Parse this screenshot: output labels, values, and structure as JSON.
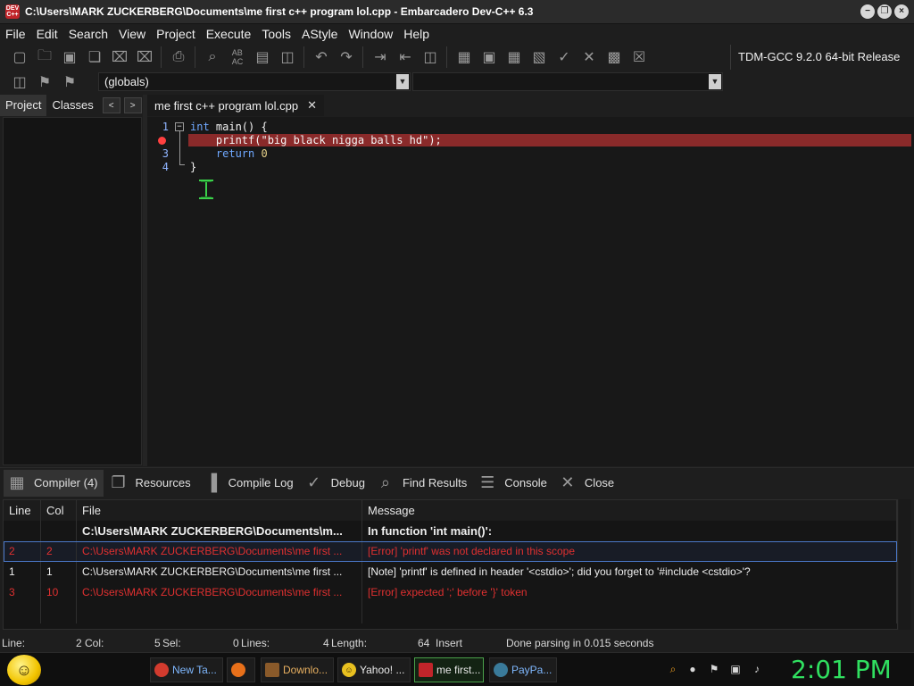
{
  "window": {
    "app_icon_text": "DEV C++",
    "title": "C:\\Users\\MARK ZUCKERBERG\\Documents\\me first c++ program lol.cpp - Embarcadero Dev-C++ 6.3",
    "minimize": "−",
    "restore": "❐",
    "close": "×"
  },
  "menu": [
    "File",
    "Edit",
    "Search",
    "View",
    "Project",
    "Execute",
    "Tools",
    "AStyle",
    "Window",
    "Help"
  ],
  "toolbar": {
    "compiler_label": "TDM-GCC 9.2.0 64-bit Release",
    "icons": [
      "new-icon",
      "open-icon",
      "save-icon",
      "save-all-icon",
      "close-file-icon",
      "close-all-icon",
      "print-icon",
      "find-icon",
      "replace-icon",
      "goto-icon",
      "toggle-view-icon",
      "undo-icon",
      "redo-icon",
      "indent-icon",
      "unindent-icon",
      "comment-icon",
      "compile-icon",
      "run-icon",
      "compile-run-icon",
      "rebuild-icon",
      "syntax-check-icon",
      "stop-icon",
      "chart-icon",
      "debug-stop-icon"
    ]
  },
  "toolbar2": {
    "class_combo": "(globals)",
    "member_combo": ""
  },
  "left_panel": {
    "tabs": [
      "Project",
      "Classes"
    ],
    "prev": "<",
    "next": ">"
  },
  "editor": {
    "tab_title": "me first c++ program lol.cpp",
    "tab_close": "✕",
    "lines": [
      {
        "num": "1",
        "pre": "",
        "kw": "int",
        "text": " main() {"
      },
      {
        "num": "",
        "pre": "    ",
        "kw": "",
        "text": "printf(\"big black nigga balls hd\");"
      },
      {
        "num": "3",
        "pre": "    ",
        "kw": "return",
        "text": " ",
        "num_lit": "0"
      },
      {
        "num": "4",
        "pre": "",
        "kw": "",
        "text": "}"
      }
    ]
  },
  "bottom_tabs": [
    {
      "label": "Compiler (4)",
      "icon": "compiler-grid-icon",
      "glyph": "▦"
    },
    {
      "label": "Resources",
      "icon": "resources-icon",
      "glyph": "❐"
    },
    {
      "label": "Compile Log",
      "icon": "compile-log-icon",
      "glyph": "▐"
    },
    {
      "label": "Debug",
      "icon": "debug-check-icon",
      "glyph": "✓"
    },
    {
      "label": "Find Results",
      "icon": "find-results-icon",
      "glyph": "⌕"
    },
    {
      "label": "Console",
      "icon": "console-icon",
      "glyph": "☰"
    },
    {
      "label": "Close",
      "icon": "close-x-icon",
      "glyph": "✕"
    }
  ],
  "messages": {
    "headers": {
      "line": "Line",
      "col": "Col",
      "file": "File",
      "message": "Message"
    },
    "rows": [
      {
        "line": "",
        "col": "",
        "file": "C:\\Users\\MARK ZUCKERBERG\\Documents\\m...",
        "message": "In function 'int main()':",
        "kind": "bold"
      },
      {
        "line": "2",
        "col": "2",
        "file": "C:\\Users\\MARK ZUCKERBERG\\Documents\\me first ...",
        "message": "[Error] 'printf' was not declared in this scope",
        "kind": "err"
      },
      {
        "line": "1",
        "col": "1",
        "file": "C:\\Users\\MARK ZUCKERBERG\\Documents\\me first ...",
        "message": "[Note] 'printf' is defined in header '<cstdio>'; did you forget to '#include <cstdio>'?",
        "kind": "note"
      },
      {
        "line": "3",
        "col": "10",
        "file": "C:\\Users\\MARK ZUCKERBERG\\Documents\\me first ...",
        "message": "[Error] expected ';' before '}' token",
        "kind": "err"
      }
    ]
  },
  "status": {
    "line_label": "Line:",
    "line_value": "2",
    "col_label": "Col:",
    "col_value": "5",
    "sel_label": "Sel:",
    "sel_value": "0",
    "lines_label": "Lines:",
    "lines_value": "4",
    "length_label": "Length:",
    "length_value": "64",
    "mode": "Insert",
    "parse_msg": "Done parsing in 0.015 seconds"
  },
  "taskbar": {
    "start_glyph": "☺",
    "tasks": [
      {
        "label": "New Ta...",
        "icon": "chrome-icon",
        "color": "#d23b2e",
        "active": false
      },
      {
        "label": "",
        "icon": "firefox-icon",
        "color": "#e8701a",
        "active": false
      },
      {
        "label": "Downlo...",
        "icon": "downloads-icon",
        "color": "#8a5a2a",
        "active": false
      },
      {
        "label": "Yahoo! ...",
        "icon": "yahoo-smiley-icon",
        "color": "#e8c020",
        "active": false
      },
      {
        "label": "me first...",
        "icon": "devcpp-icon",
        "color": "#c0252a",
        "active": true
      },
      {
        "label": "PayPa...",
        "icon": "paypal-shield-icon",
        "color": "#3a7a9a",
        "active": false
      }
    ],
    "tray_glyphs": [
      "⌕",
      "●",
      "⚑",
      "▣",
      "♪"
    ],
    "clock": "2:01 PM"
  },
  "colors": {
    "error_line": "#8a2a2a",
    "error_text": "#e03030",
    "clock": "#30e060",
    "keyword": "#6fa8ff"
  }
}
